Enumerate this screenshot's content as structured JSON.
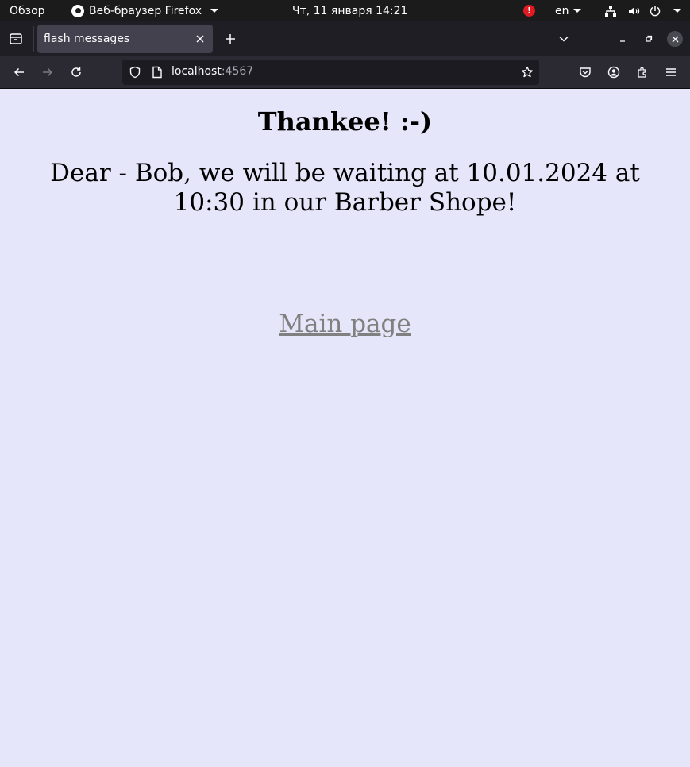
{
  "system_bar": {
    "overview": "Обзор",
    "app_name": "Веб-браузер Firefox",
    "clock": "Чт, 11 января  14:21",
    "alert_glyph": "!",
    "language": "en"
  },
  "browser": {
    "tab_title": "flash messages",
    "url_host": "localhost",
    "url_port": ":4567"
  },
  "page": {
    "heading": "Thankee! :-)",
    "message": "Dear - Bob, we will be waiting at 10.01.2024 at 10:30 in our Barber Shope!",
    "link_text": "Main page",
    "background_color": "#e6e6fa",
    "link_color": "#808080"
  },
  "icons": {
    "firefox": "firefox-icon",
    "network": "network-icon",
    "volume": "volume-icon",
    "power": "power-icon",
    "back": "back-arrow-icon",
    "forward": "forward-arrow-icon",
    "reload": "reload-icon",
    "shield": "shield-icon",
    "page": "page-icon",
    "bookmark": "star-icon",
    "pocket": "pocket-icon",
    "account": "account-icon",
    "extensions": "puzzle-icon",
    "menu": "hamburger-menu-icon"
  }
}
